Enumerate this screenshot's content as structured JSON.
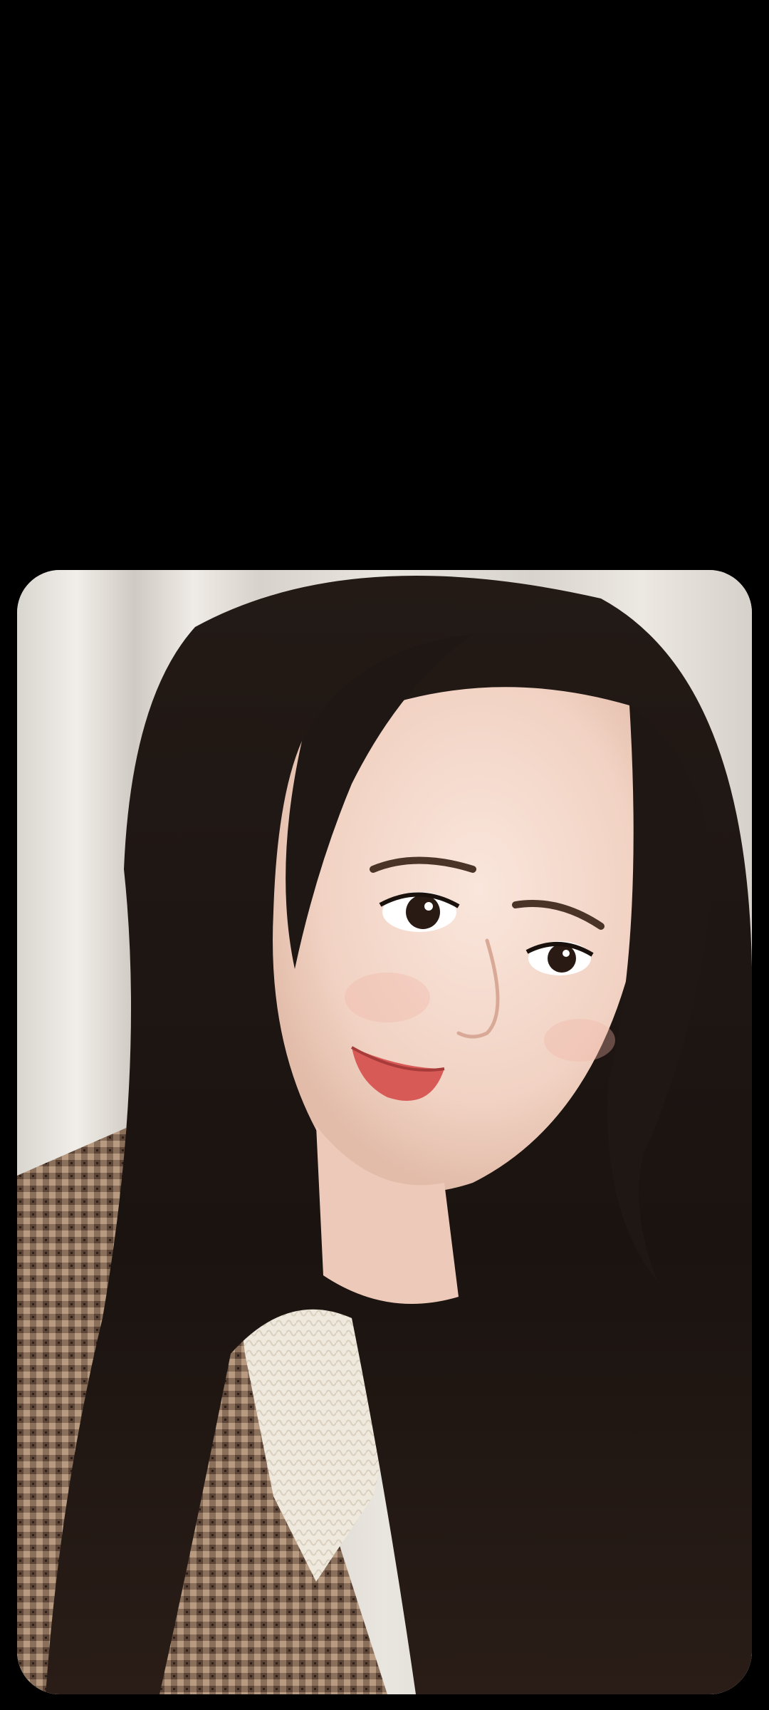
{
  "photo": {
    "subject": "selfie portrait",
    "colors": {
      "background": "#000000",
      "curtain": "#e6e2dc",
      "hair": "#1a1310",
      "skin": "#f3d6c8",
      "lips": "#d85a57",
      "sweater": "#efe8dc",
      "coat": "#7a6452"
    }
  }
}
